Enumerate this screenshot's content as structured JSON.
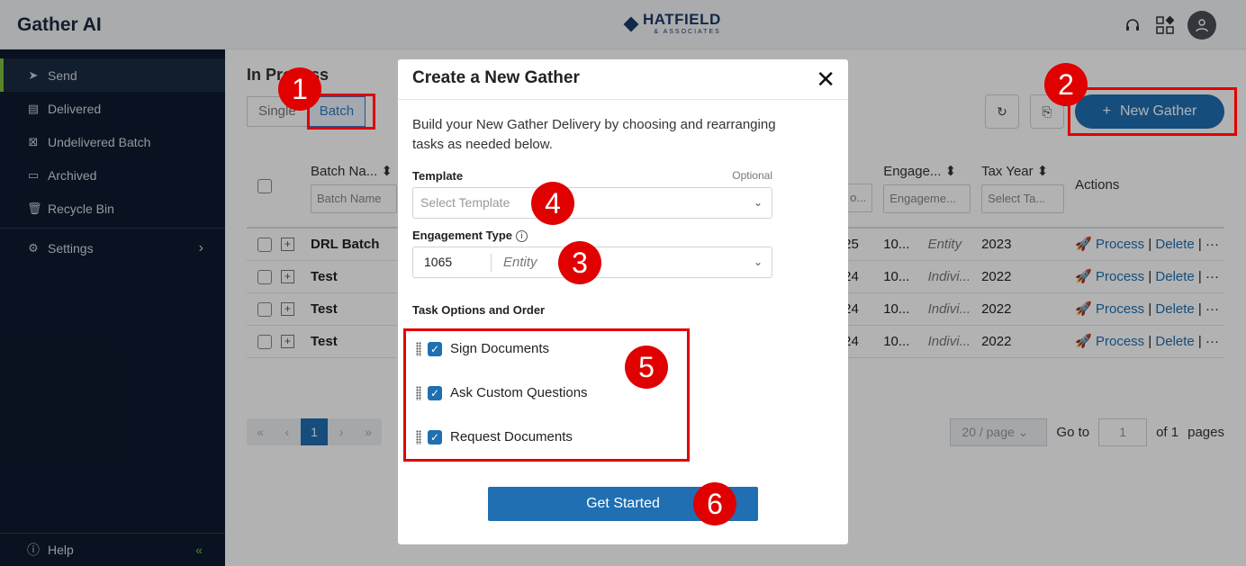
{
  "app": {
    "brand": "Gather AI",
    "logo_name": "HATFIELD",
    "logo_sub": "& ASSOCIATES"
  },
  "topbar": {
    "icons": [
      "headset-icon",
      "apps-icon",
      "user-avatar-icon"
    ]
  },
  "sidebar": {
    "items": [
      {
        "label": "Send",
        "icon": "send-icon"
      },
      {
        "label": "Delivered",
        "icon": "document-icon"
      },
      {
        "label": "Undelivered Batch",
        "icon": "x-document-icon"
      },
      {
        "label": "Archived",
        "icon": "archive-icon"
      },
      {
        "label": "Recycle Bin",
        "icon": "trash-icon"
      }
    ],
    "settings": "Settings",
    "help": "Help"
  },
  "main": {
    "title": "In Process",
    "segments": [
      "Single",
      "Batch"
    ],
    "new_button": "New Gather",
    "columns": {
      "batch_name": "Batch Na...",
      "batch_filter": "Batch Name",
      "engage": "Engage...",
      "engage_filter": "Engageme...",
      "tax_year": "Tax Year",
      "tax_filter": "Select Ta...",
      "actions": "Actions",
      "hidden_filter": "o..."
    },
    "rows": [
      {
        "name": "DRL Batch",
        "num": "25",
        "eng": "10...",
        "type": "Entity",
        "year": "2023"
      },
      {
        "name": "Test",
        "num": "24",
        "eng": "10...",
        "type": "Indivi...",
        "year": "2022"
      },
      {
        "name": "Test",
        "num": "24",
        "eng": "10...",
        "type": "Indivi...",
        "year": "2022"
      },
      {
        "name": "Test",
        "num": "24",
        "eng": "10...",
        "type": "Indivi...",
        "year": "2022"
      }
    ],
    "actions": {
      "process": "Process",
      "delete": "Delete",
      "more": "···"
    },
    "pagination": {
      "current": "1",
      "per_page": "20 / page",
      "goto": "Go to",
      "goto_value": "1",
      "of": "of 1",
      "pages": "pages"
    }
  },
  "modal": {
    "title": "Create a New Gather",
    "description": "Build your New Gather Delivery by choosing and rearranging tasks as needed below.",
    "template_label": "Template",
    "optional": "Optional",
    "template_placeholder": "Select Template",
    "engagement_label": "Engagement Type",
    "engagement_code": "1065",
    "engagement_type": "Entity",
    "tasks_label": "Task Options and Order",
    "tasks": [
      "Sign Documents",
      "Ask Custom Questions",
      "Request Documents"
    ],
    "submit": "Get Started"
  },
  "callouts": [
    "1",
    "2",
    "3",
    "4",
    "5",
    "6"
  ],
  "colors": {
    "primary": "#1f6fb2",
    "sidebar": "#0d1b2e",
    "callout": "#e00000",
    "accent": "#7fbf3a"
  }
}
